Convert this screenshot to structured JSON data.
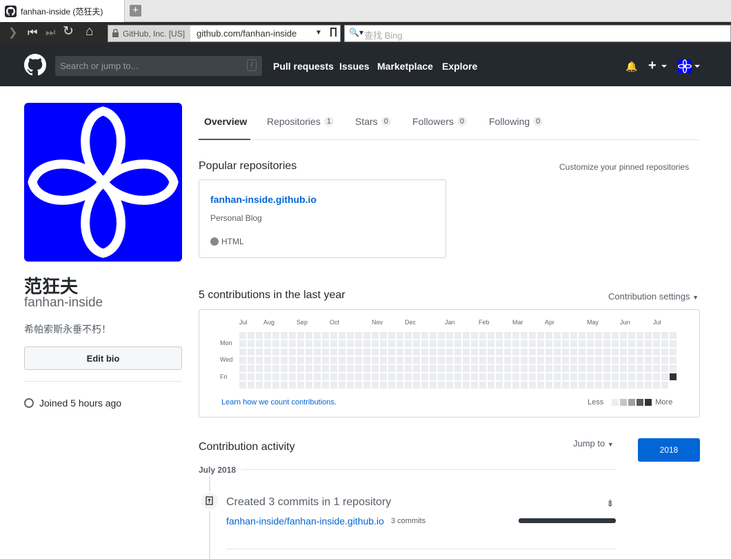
{
  "browser": {
    "tab_title": "fanhan-inside (范狂夫)",
    "new_tab_icon": "+",
    "identity": "GitHub, Inc. [US]",
    "url": "github.com/fanhan-inside",
    "search_placeholder": "查找 Bing"
  },
  "github_header": {
    "search_placeholder": "Search or jump to...",
    "search_shortcut": "/",
    "nav": [
      "Pull requests",
      "Issues",
      "Marketplace",
      "Explore"
    ]
  },
  "profile": {
    "name": "范狂夫",
    "login": "fanhan-inside",
    "bio": "希帕索斯永垂不朽！",
    "edit_bio": "Edit bio",
    "joined": "Joined 5 hours ago",
    "avatar_color": "#0000ff"
  },
  "tabs": [
    {
      "label": "Overview",
      "count": ""
    },
    {
      "label": "Repositories",
      "count": "1"
    },
    {
      "label": "Stars",
      "count": "0"
    },
    {
      "label": "Followers",
      "count": "0"
    },
    {
      "label": "Following",
      "count": "0"
    }
  ],
  "popular": {
    "heading": "Popular repositories",
    "customize": "Customize your pinned repositories",
    "repo": {
      "name": "fanhan-inside.github.io",
      "description": "Personal Blog",
      "language": "HTML"
    }
  },
  "contributions": {
    "heading": "5 contributions in the last year",
    "settings": "Contribution settings",
    "months": [
      "Jul",
      "Aug",
      "Sep",
      "Oct",
      "Nov",
      "Dec",
      "Jan",
      "Feb",
      "Mar",
      "Apr",
      "May",
      "Jun",
      "Jul"
    ],
    "days": [
      "Mon",
      "Wed",
      "Fri"
    ],
    "learn_link": "Learn how we count contributions.",
    "legend_less": "Less",
    "legend_more": "More",
    "legend_colors": [
      "#ebedf0",
      "#c6c6c6",
      "#a0a0a0",
      "#5a5a5a",
      "#333333"
    ],
    "active_cell_color": "#333333"
  },
  "activity": {
    "heading": "Contribution activity",
    "jump_to": "Jump to",
    "year": "2018",
    "month": "July 2018",
    "summary_title": "Created 3 commits in 1 repository",
    "repo": "fanhan-inside/fanhan-inside.github.io",
    "commits": "3 commits"
  },
  "colors": {
    "github_dark": "#24292e",
    "link_blue": "#0366d6"
  }
}
